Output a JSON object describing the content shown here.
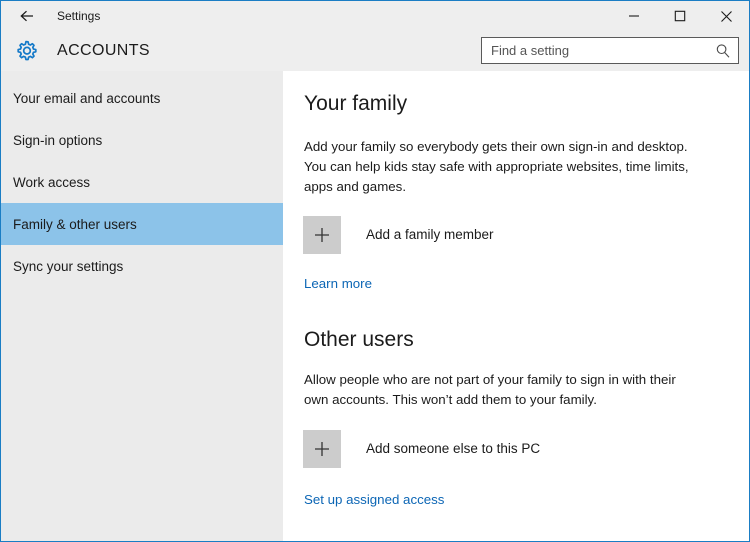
{
  "window": {
    "titlebar": {
      "back_icon": "back-arrow-icon",
      "title": "Settings",
      "minimize_label": "Minimize",
      "maximize_label": "Maximize",
      "close_label": "Close"
    },
    "app_header": {
      "icon": "gear-icon",
      "title": "ACCOUNTS"
    },
    "search": {
      "placeholder": "Find a setting",
      "value": "",
      "icon": "search-icon"
    },
    "border_color": "#1a7dc4"
  },
  "sidebar": {
    "background": "#ebebeb",
    "selected_color": "#8cc3e9",
    "items": [
      {
        "label": "Your email and accounts",
        "selected": false
      },
      {
        "label": "Sign-in options",
        "selected": false
      },
      {
        "label": "Work access",
        "selected": false
      },
      {
        "label": "Family & other users",
        "selected": true
      },
      {
        "label": "Sync your settings",
        "selected": false
      }
    ]
  },
  "main": {
    "sections": [
      {
        "heading": "Your family",
        "description": "Add your family so everybody gets their own sign-in and desktop. You can help kids stay safe with appropriate websites, time limits, apps and games.",
        "action": {
          "icon": "plus-icon",
          "label": "Add a family member"
        },
        "link": "Learn more"
      },
      {
        "heading": "Other users",
        "description": "Allow people who are not part of your family to sign in with their own accounts. This won’t add them to your family.",
        "action": {
          "icon": "plus-icon",
          "label": "Add someone else to this PC"
        },
        "link": "Set up assigned access"
      }
    ],
    "link_color": "#0c66b5"
  }
}
